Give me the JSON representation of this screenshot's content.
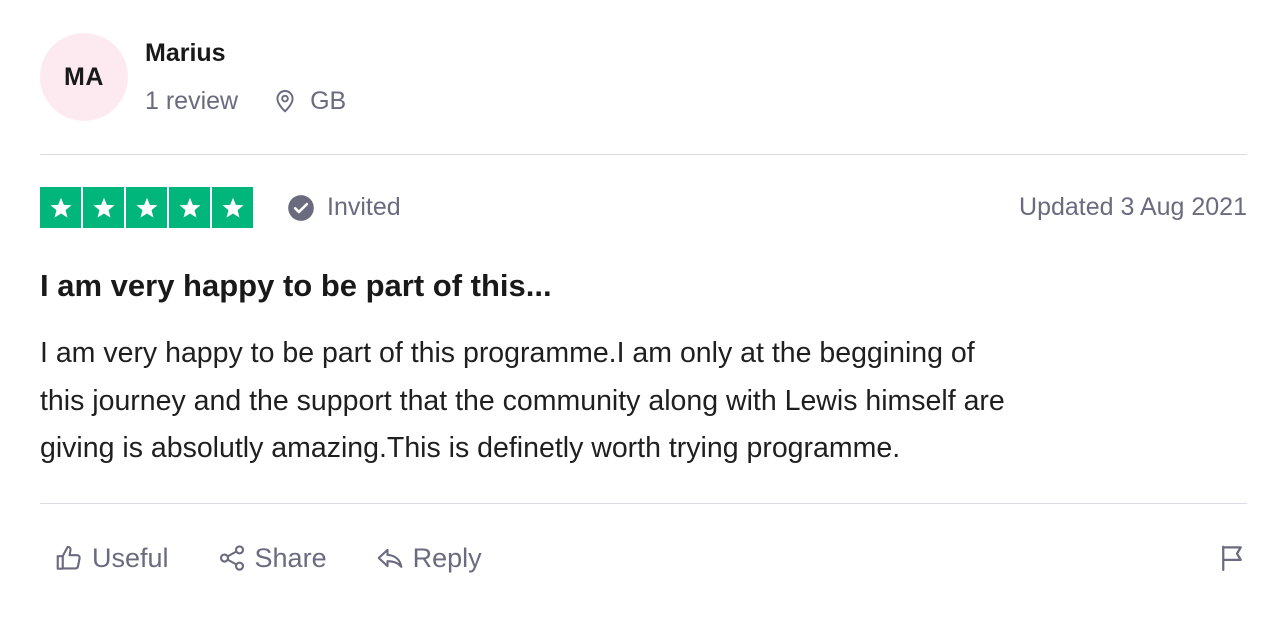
{
  "consumer": {
    "initials": "MA",
    "name": "Marius",
    "review_count": "1 review",
    "location": "GB"
  },
  "rating": {
    "stars": 5,
    "max_stars": 5,
    "badge": "Invited",
    "date": "Updated 3 Aug 2021"
  },
  "review": {
    "title": "I am very happy to be part of this...",
    "body_lines": [
      "I am very happy to be part of this programme.I am only at the beggining of",
      "this journey and the support that the community along with Lewis himself are",
      "giving is absolutly amazing.This is definetly worth trying programme."
    ]
  },
  "actions": {
    "useful_label": "Useful",
    "share_label": "Share",
    "reply_label": "Reply"
  },
  "colors": {
    "star_green": "#00b67a",
    "avatar_bg": "#fdeaf1",
    "muted_text": "#6b6b80"
  },
  "icons": [
    "location-pin-icon",
    "star-icon",
    "verified-check-icon",
    "thumbs-up-icon",
    "share-icon",
    "reply-icon",
    "flag-icon"
  ]
}
